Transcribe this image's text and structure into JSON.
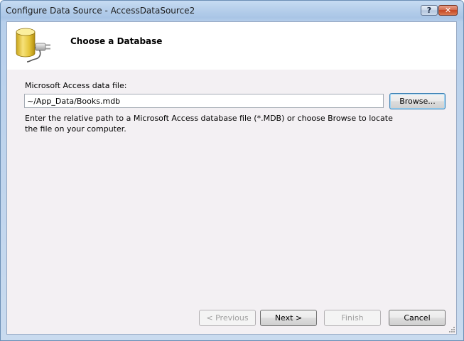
{
  "window": {
    "title": "Configure Data Source - AccessDataSource2",
    "help_button": "?",
    "close_button": "✕"
  },
  "header": {
    "title": "Choose a Database",
    "icon": "database-plug-icon"
  },
  "form": {
    "label": "Microsoft Access data file:",
    "path_value": "~/App_Data/Books.mdb",
    "browse_label": "Browse...",
    "help_text": "Enter the relative path to a Microsoft Access database file (*.MDB) or choose Browse to locate the file on your computer."
  },
  "footer": {
    "previous_label": "< Previous",
    "next_label": "Next >",
    "finish_label": "Finish",
    "cancel_label": "Cancel"
  },
  "colors": {
    "titlebar": "#b9d1ec",
    "client_bg": "#f3f0f3",
    "header_bg": "#ffffff",
    "close_red": "#c5431f",
    "focus_blue": "#3c7fb1"
  }
}
